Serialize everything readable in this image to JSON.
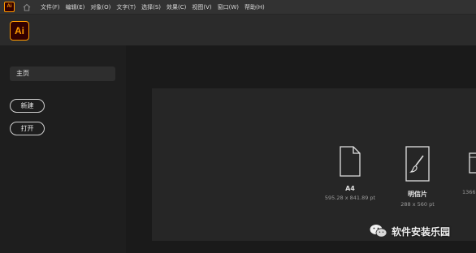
{
  "app": {
    "logo_text": "Ai",
    "mini_logo_text": "Ai"
  },
  "menu": [
    {
      "label": "文件(F)"
    },
    {
      "label": "编辑(E)"
    },
    {
      "label": "对象(O)"
    },
    {
      "label": "文字(T)"
    },
    {
      "label": "选择(S)"
    },
    {
      "label": "效果(C)"
    },
    {
      "label": "视图(V)"
    },
    {
      "label": "窗口(W)"
    },
    {
      "label": "帮助(H)"
    }
  ],
  "sidebar": {
    "home_label": "主页",
    "new_label": "新建",
    "open_label": "打开"
  },
  "presets": [
    {
      "name": "A4",
      "dims": "595.28 x 841.89 pt",
      "icon": "document-icon"
    },
    {
      "name": "明信片",
      "dims": "288 x 560 pt",
      "icon": "brush-icon"
    },
    {
      "name": "",
      "dims": "1366",
      "icon": "screen-icon"
    }
  ],
  "watermark": {
    "text": "软件安装乐园",
    "icon": "wechat-icon"
  },
  "colors": {
    "accent": "#ff9a00",
    "logo_bg": "#330000",
    "menubar": "#323232",
    "header": "#2b2b2b",
    "card": "#262626"
  }
}
